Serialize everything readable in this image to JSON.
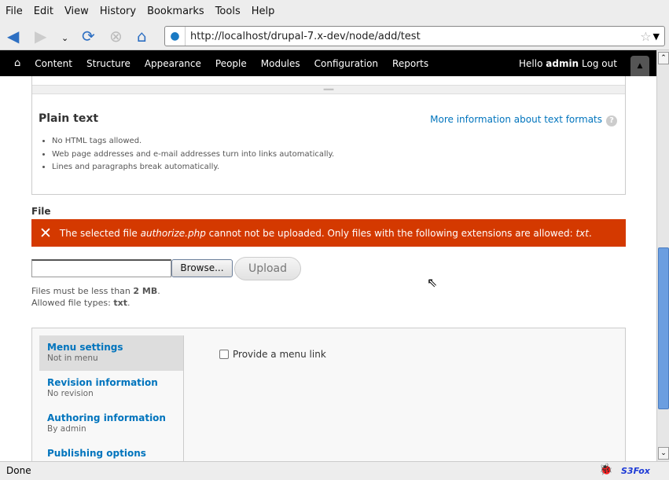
{
  "browser": {
    "menu": [
      "File",
      "Edit",
      "View",
      "History",
      "Bookmarks",
      "Tools",
      "Help"
    ],
    "url": "http://localhost/drupal-7.x-dev/node/add/test",
    "status": "Done",
    "addon": "S3Fox"
  },
  "toolbar": {
    "items": [
      "Content",
      "Structure",
      "Appearance",
      "People",
      "Modules",
      "Configuration",
      "Reports"
    ],
    "hello": "Hello",
    "user": "admin",
    "logout": "Log out"
  },
  "format": {
    "title": "Plain text",
    "more": "More information about text formats",
    "tips": [
      "No HTML tags allowed.",
      "Web page addresses and e-mail addresses turn into links automatically.",
      "Lines and paragraphs break automatically."
    ]
  },
  "file": {
    "label": "File",
    "error": {
      "pre": "The selected file ",
      "file": "authorize.php",
      "mid": " cannot not be uploaded. Only files with the following extensions are allowed: ",
      "ext": "txt",
      "end": "."
    },
    "browse": "Browse...",
    "upload": "Upload",
    "help1_pre": "Files must be less than ",
    "help1_val": "2 MB",
    "help1_end": ".",
    "help2_pre": "Allowed file types: ",
    "help2_val": "txt",
    "help2_end": "."
  },
  "vtabs": [
    {
      "title": "Menu settings",
      "summary": "Not in menu"
    },
    {
      "title": "Revision information",
      "summary": "No revision"
    },
    {
      "title": "Authoring information",
      "summary": "By admin"
    },
    {
      "title": "Publishing options",
      "summary": ""
    }
  ],
  "menu_link_label": "Provide a menu link"
}
